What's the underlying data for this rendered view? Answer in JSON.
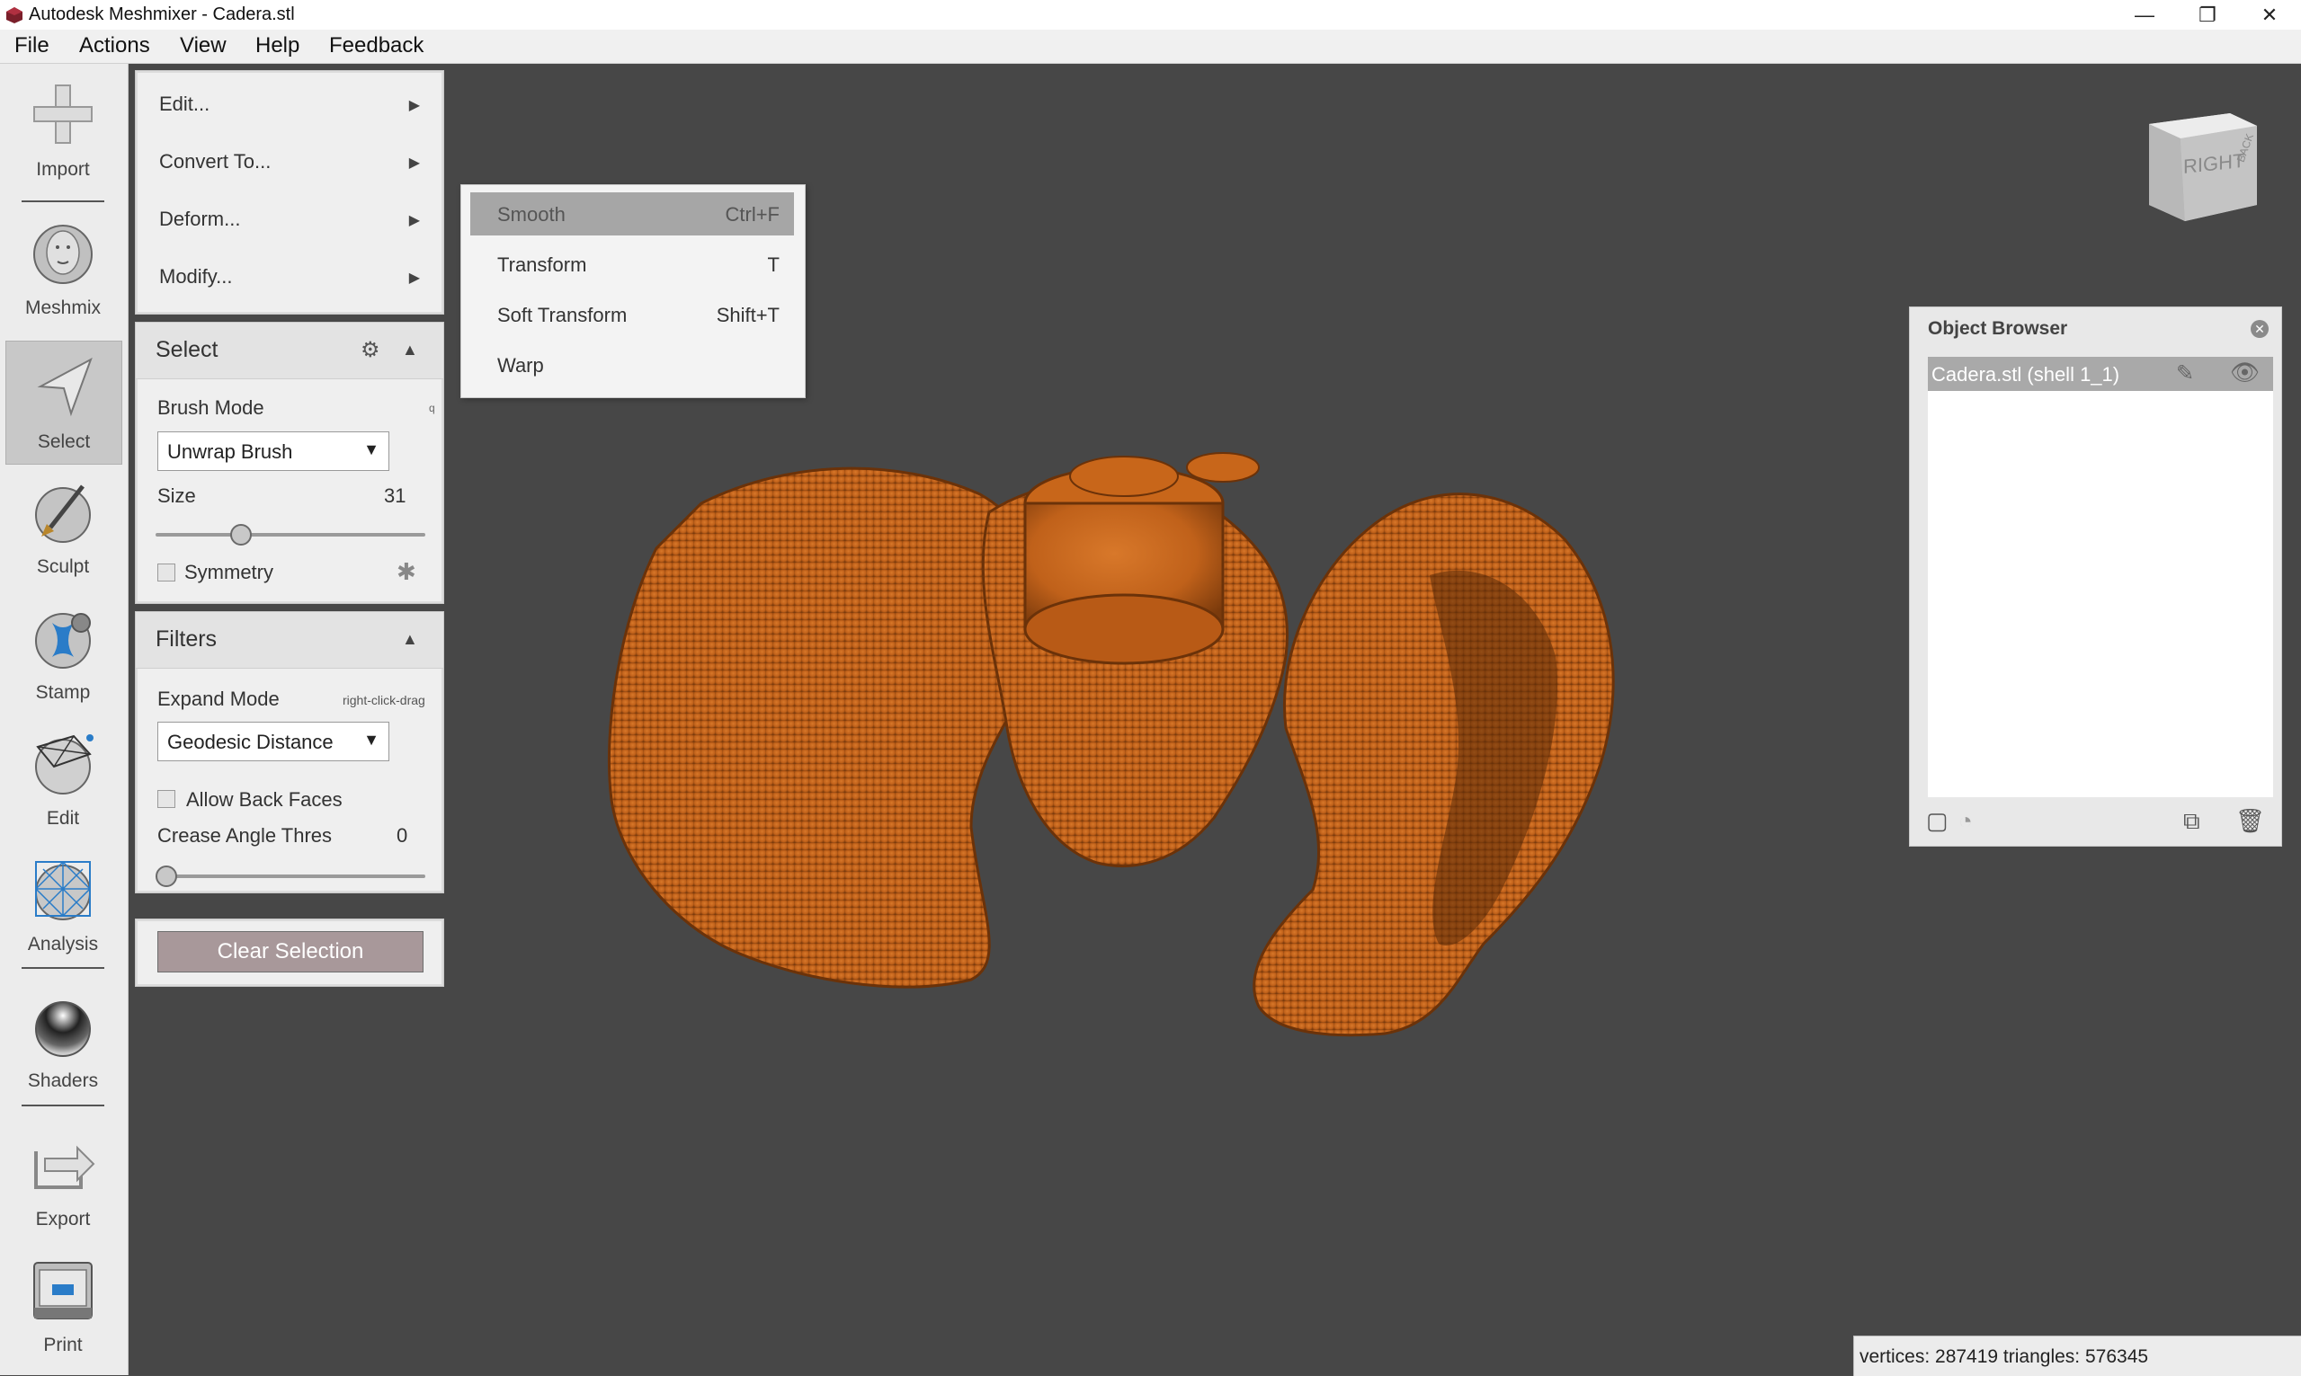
{
  "window": {
    "title": "Autodesk Meshmixer - Cadera.stl",
    "controls": [
      "minimize",
      "restore",
      "close"
    ]
  },
  "menubar": {
    "items": [
      "File",
      "Actions",
      "View",
      "Help",
      "Feedback"
    ]
  },
  "toolbar": {
    "tools": [
      {
        "label": "Import",
        "icon": "plus-icon"
      },
      {
        "label": "Meshmix",
        "icon": "face-sphere-icon"
      },
      {
        "label": "Select",
        "icon": "cursor-arrow-icon",
        "active": true
      },
      {
        "label": "Sculpt",
        "icon": "brush-sphere-icon"
      },
      {
        "label": "Stamp",
        "icon": "stamp-sphere-icon"
      },
      {
        "label": "Edit",
        "icon": "wireframe-sphere-icon"
      },
      {
        "label": "Analysis",
        "icon": "mesh-sphere-icon"
      },
      {
        "label": "Shaders",
        "icon": "chrome-sphere-icon"
      },
      {
        "label": "Export",
        "icon": "export-arrow-icon"
      },
      {
        "label": "Print",
        "icon": "printer-icon"
      }
    ]
  },
  "edit_panel": {
    "items": [
      "Edit...",
      "Convert To...",
      "Deform...",
      "Modify..."
    ]
  },
  "select_panel": {
    "title": "Select",
    "brush_mode_label": "Brush Mode",
    "brush_mode_hotkey": "q",
    "brush_mode_value": "Unwrap Brush",
    "size_label": "Size",
    "size_value": "31",
    "size_fraction": 0.3,
    "symmetry_label": "Symmetry"
  },
  "filters_panel": {
    "title": "Filters",
    "expand_mode_label": "Expand Mode",
    "expand_mode_hint": "right-click-drag",
    "expand_mode_value": "Geodesic Distance",
    "allow_back_faces_label": "Allow Back Faces",
    "crease_label": "Crease Angle Thres",
    "crease_value": "0",
    "crease_fraction": 0.0
  },
  "clear_selection_label": "Clear Selection",
  "deform_submenu": {
    "items": [
      {
        "label": "Smooth",
        "shortcut": "Ctrl+F",
        "highlighted": true
      },
      {
        "label": "Transform",
        "shortcut": "T"
      },
      {
        "label": "Soft Transform",
        "shortcut": "Shift+T"
      },
      {
        "label": "Warp",
        "shortcut": ""
      }
    ]
  },
  "viewcube": {
    "front": "RIGHT",
    "side": "BACK"
  },
  "object_browser": {
    "title": "Object Browser",
    "objects": [
      {
        "name": "Cadera.stl (shell 1_1)"
      }
    ]
  },
  "status": {
    "text": "vertices: 287419 triangles: 576345"
  },
  "colors": {
    "model": "#c8661a",
    "viewport": "#474747",
    "highlight": "#a6a6a6"
  }
}
